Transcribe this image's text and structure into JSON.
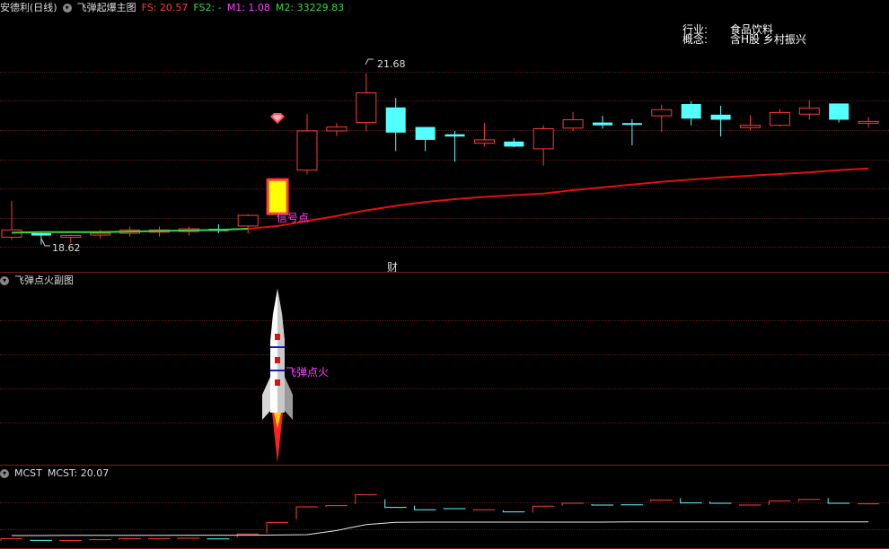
{
  "main": {
    "stock_title": "安德利(日线)",
    "indicator_name": "飞弹起爆主图",
    "fs_text": "FS: 20.57",
    "fs2_text": "FS2: -",
    "m1_text": "M1: 1.08",
    "m2_text": "M2: 33229.83",
    "high_label": "21.68",
    "low_label": "18.62",
    "signal_label": "信号点",
    "finance_marker": "财"
  },
  "info": {
    "industry_label": "行业:",
    "industry_value": "食品饮料",
    "concept_label": "概念:",
    "concept_value": "含H股 乡村振兴"
  },
  "sub": {
    "indicator_name": "飞弹点火副图",
    "ignition_label": "飞弹点火"
  },
  "mcst": {
    "name": "MCST",
    "value_text": "MCST: 20.07"
  },
  "colors": {
    "up": "#ff3a3a",
    "down": "#54ffff",
    "ma": "#e01010",
    "ma_early": "#3bd63b",
    "signal_bar": "#ffff00"
  },
  "chart_data": {
    "type": "candlestick",
    "price_range": [
      18.5,
      21.9
    ],
    "candles": [
      {
        "o": 18.75,
        "h": 19.4,
        "l": 18.7,
        "c": 18.88
      },
      {
        "o": 18.82,
        "h": 18.85,
        "l": 18.62,
        "c": 18.78
      },
      {
        "o": 18.75,
        "h": 18.8,
        "l": 18.65,
        "c": 18.78
      },
      {
        "o": 18.8,
        "h": 18.88,
        "l": 18.72,
        "c": 18.82
      },
      {
        "o": 18.82,
        "h": 18.94,
        "l": 18.76,
        "c": 18.88
      },
      {
        "o": 18.84,
        "h": 18.94,
        "l": 18.76,
        "c": 18.88
      },
      {
        "o": 18.85,
        "h": 18.94,
        "l": 18.78,
        "c": 18.9
      },
      {
        "o": 18.9,
        "h": 18.98,
        "l": 18.82,
        "c": 18.86
      },
      {
        "o": 18.95,
        "h": 19.16,
        "l": 18.82,
        "c": 19.14
      },
      {
        "o": 19.17,
        "h": 19.81,
        "l": 19.16,
        "c": 19.78
      },
      {
        "o": 19.95,
        "h": 20.95,
        "l": 19.87,
        "c": 20.65
      },
      {
        "o": 20.65,
        "h": 20.79,
        "l": 20.56,
        "c": 20.72
      },
      {
        "o": 20.8,
        "h": 21.68,
        "l": 20.64,
        "c": 21.33
      },
      {
        "o": 21.07,
        "h": 21.24,
        "l": 20.29,
        "c": 20.62
      },
      {
        "o": 20.72,
        "h": 20.72,
        "l": 20.29,
        "c": 20.49
      },
      {
        "o": 20.59,
        "h": 20.65,
        "l": 20.1,
        "c": 20.55
      },
      {
        "o": 20.43,
        "h": 20.79,
        "l": 20.37,
        "c": 20.49
      },
      {
        "o": 20.46,
        "h": 20.52,
        "l": 20.36,
        "c": 20.37
      },
      {
        "o": 20.33,
        "h": 20.75,
        "l": 20.03,
        "c": 20.69
      },
      {
        "o": 20.7,
        "h": 20.99,
        "l": 20.65,
        "c": 20.85
      },
      {
        "o": 20.8,
        "h": 20.92,
        "l": 20.69,
        "c": 20.75
      },
      {
        "o": 20.79,
        "h": 20.86,
        "l": 20.39,
        "c": 20.76
      },
      {
        "o": 20.92,
        "h": 21.12,
        "l": 20.63,
        "c": 21.03
      },
      {
        "o": 21.13,
        "h": 21.18,
        "l": 20.75,
        "c": 20.87
      },
      {
        "o": 20.94,
        "h": 21.1,
        "l": 20.55,
        "c": 20.85
      },
      {
        "o": 20.71,
        "h": 20.93,
        "l": 20.66,
        "c": 20.75
      },
      {
        "o": 20.75,
        "h": 21.04,
        "l": 20.73,
        "c": 20.98
      },
      {
        "o": 20.95,
        "h": 21.2,
        "l": 20.85,
        "c": 21.06
      },
      {
        "o": 21.14,
        "h": 21.14,
        "l": 20.8,
        "c": 20.85
      },
      {
        "o": 20.82,
        "h": 20.9,
        "l": 20.71,
        "c": 20.82
      }
    ],
    "ma_line": [
      18.83,
      18.84,
      18.84,
      18.84,
      18.85,
      18.86,
      18.87,
      18.88,
      18.9,
      18.95,
      19.04,
      19.13,
      19.23,
      19.31,
      19.38,
      19.43,
      19.47,
      19.5,
      19.53,
      19.59,
      19.64,
      19.69,
      19.74,
      19.78,
      19.82,
      19.85,
      19.88,
      19.91,
      19.95,
      19.98
    ],
    "mcst_line": [
      19.05,
      19.05,
      19.06,
      19.06,
      19.06,
      19.06,
      19.07,
      19.07,
      19.07,
      19.08,
      19.1,
      19.33,
      19.66,
      19.79,
      19.8,
      19.8,
      19.8,
      19.8,
      19.8,
      19.8,
      19.8,
      19.81,
      19.81,
      19.81,
      19.81,
      19.81,
      19.81,
      19.81,
      19.81,
      19.81
    ],
    "signal_index": 9,
    "green_ma_until": 8
  }
}
